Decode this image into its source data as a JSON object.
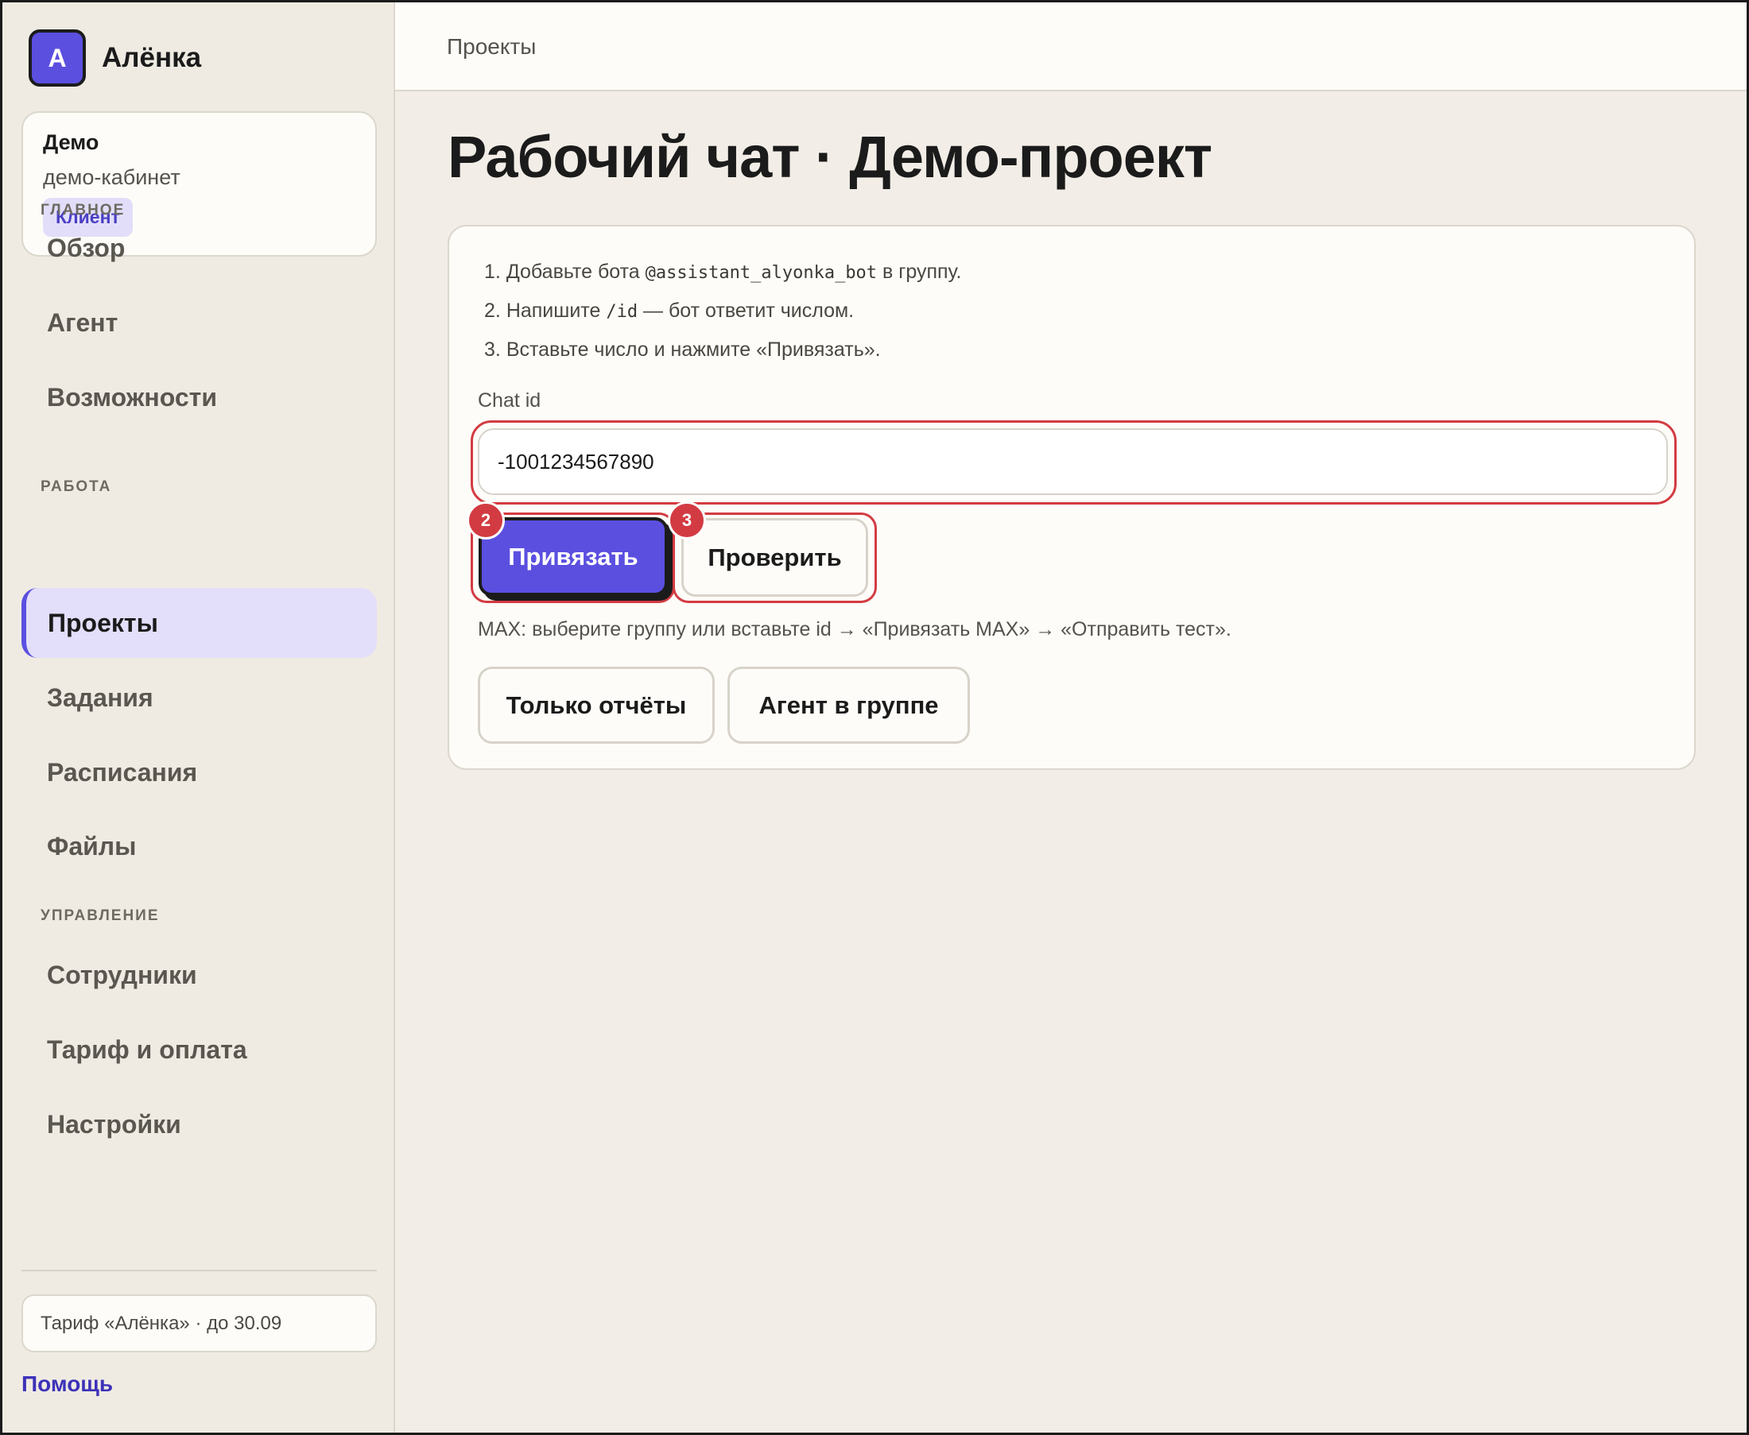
{
  "app": {
    "logo_letter": "А",
    "name": "Алёнка"
  },
  "account": {
    "name": "Демо",
    "subtitle": "демо-кабинет",
    "role_badge": "Клиент"
  },
  "sidebar": {
    "sections": [
      {
        "label": "ГЛАВНОЕ",
        "items": [
          "Обзор",
          "Агент",
          "Возможности"
        ]
      },
      {
        "label": "РАБОТА",
        "items": [
          "Проекты",
          "Задания",
          "Расписания",
          "Файлы"
        ]
      },
      {
        "label": "УПРАВЛЕНИЕ",
        "items": [
          "Сотрудники",
          "Тариф и оплата",
          "Настройки"
        ]
      }
    ],
    "active_item": "Проекты",
    "plan": "Тариф «Алёнка» · до 30.09",
    "help": "Помощь"
  },
  "header": {
    "breadcrumb": "Проекты"
  },
  "page": {
    "title": "Рабочий чат · Демо-проект",
    "steps": [
      {
        "num": "1.",
        "before": "Добавьте бота ",
        "code": "@assistant_alyonka_bot",
        "after": " в группу."
      },
      {
        "num": "2.",
        "before": "Напишите ",
        "code": "/id",
        "after": " — бот ответит числом."
      },
      {
        "num": "3.",
        "before": "Вставьте число и нажмите «Привязать».",
        "code": "",
        "after": ""
      }
    ],
    "chat_id_label": "Chat id",
    "chat_id_value": "-1001234567890",
    "bind_button": "Привязать",
    "check_button": "Проверить",
    "markers": [
      "2",
      "3"
    ],
    "max_hint": "MAX: выберите группу или вставьте id → «Привязать MAX» → «Отправить тест».",
    "mode_buttons": [
      "Только отчёты",
      "Агент в группе"
    ]
  },
  "colors": {
    "accent": "#5b4fe0",
    "highlight": "#d33b42",
    "background": "#f2ede6",
    "card": "#fdfcf8"
  }
}
